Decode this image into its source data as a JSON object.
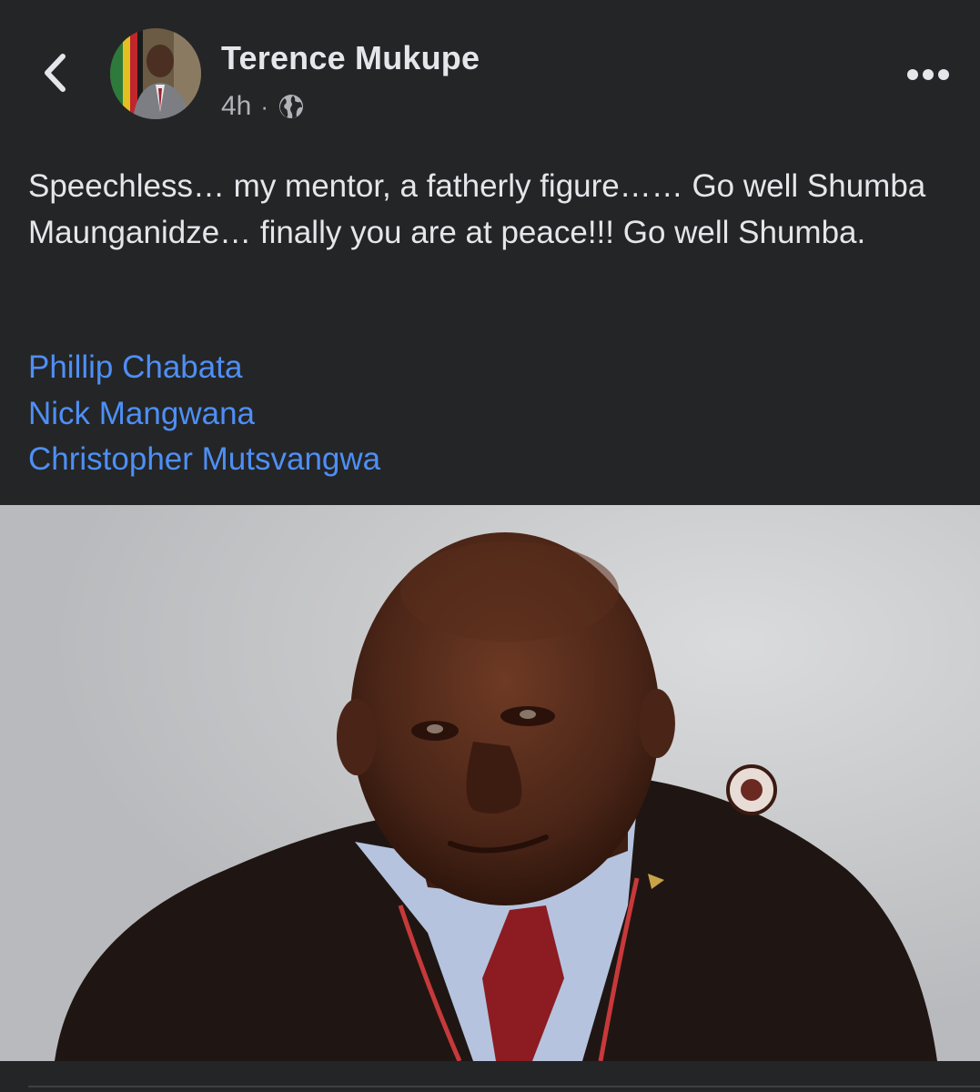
{
  "post": {
    "author": "Terence Mukupe",
    "time": "4h",
    "separator": "·",
    "privacy_icon": "globe-icon",
    "text": "Speechless… my mentor, a fatherly figure…… Go well Shumba Maunganidze… finally you are at peace!!! Go well Shumba.",
    "tags": [
      "Phillip Chabata",
      "Nick Mangwana",
      "Christopher Mutsvangwa"
    ]
  },
  "icons": {
    "back": "chevron-left-icon",
    "more": "more-horizontal-icon"
  },
  "colors": {
    "background": "#242526",
    "text": "#e4e6eb",
    "secondary_text": "#b0b3b8",
    "link": "#4e8ff5"
  }
}
